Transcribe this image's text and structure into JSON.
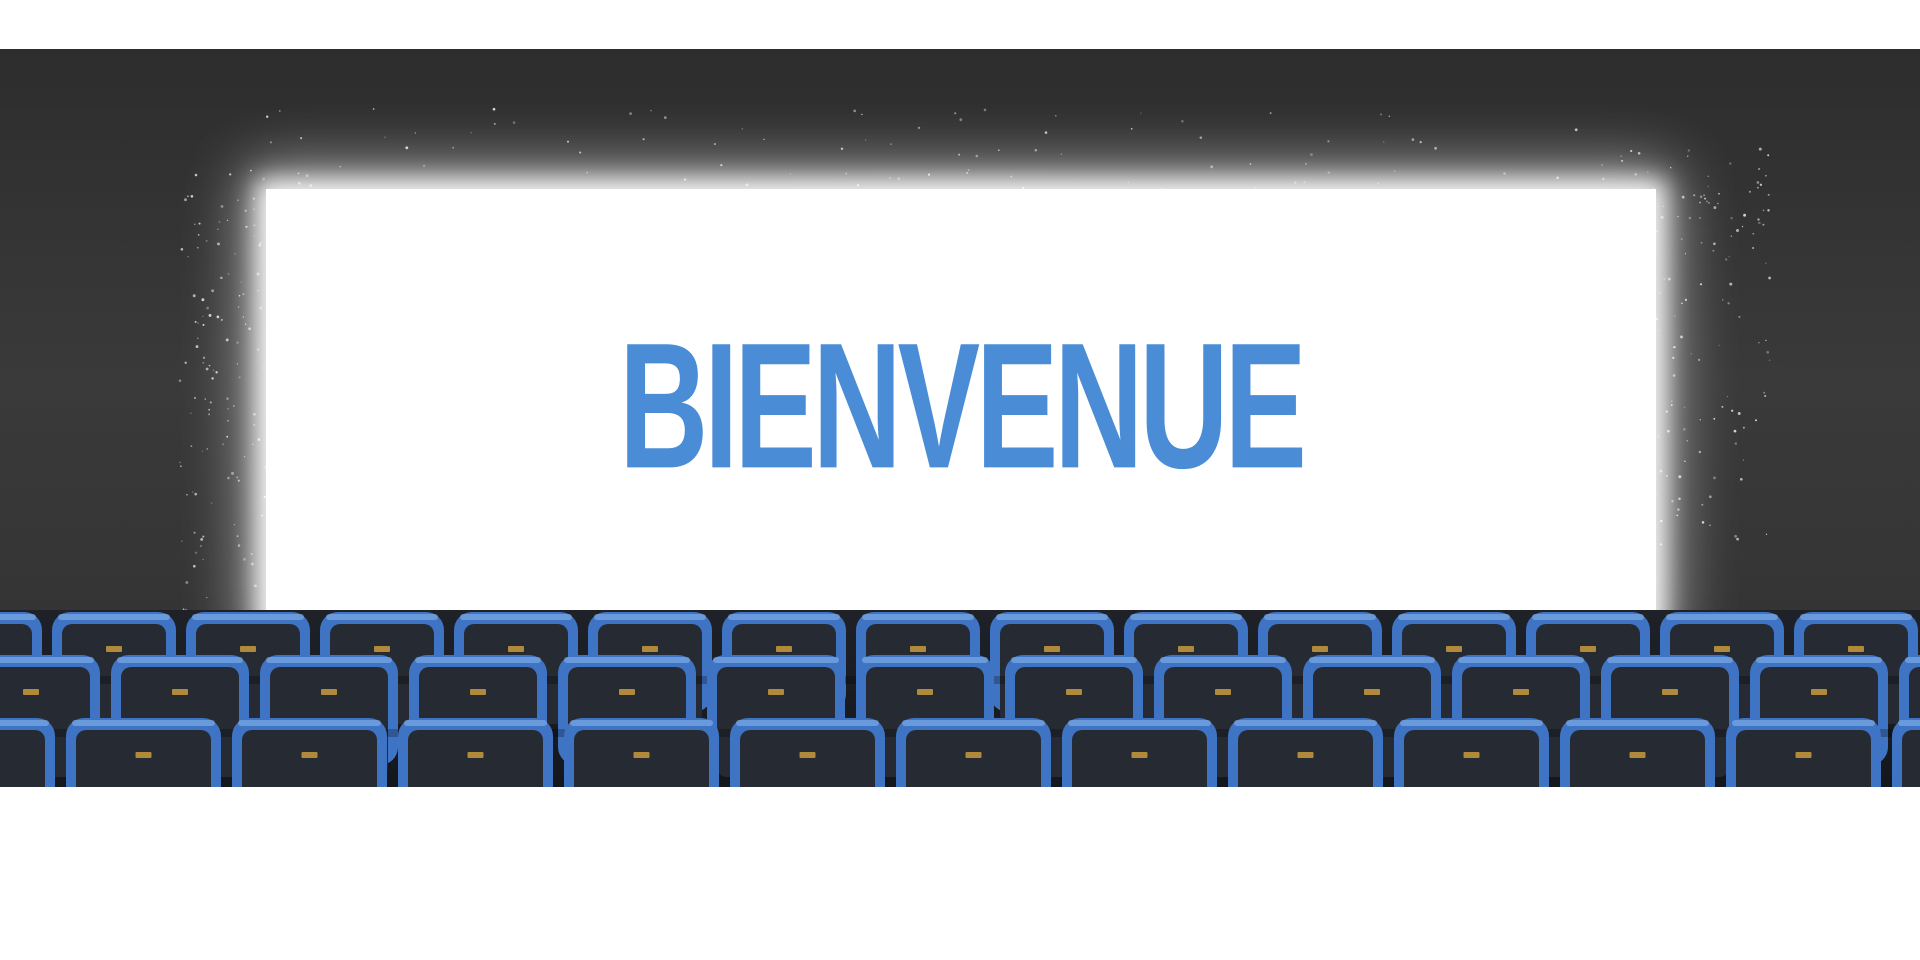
{
  "screen": {
    "title": "BIENVENUE",
    "title_color": "#4a8dd6"
  },
  "seats": {
    "color": "#3f74c4",
    "back_color": "#262b33"
  }
}
